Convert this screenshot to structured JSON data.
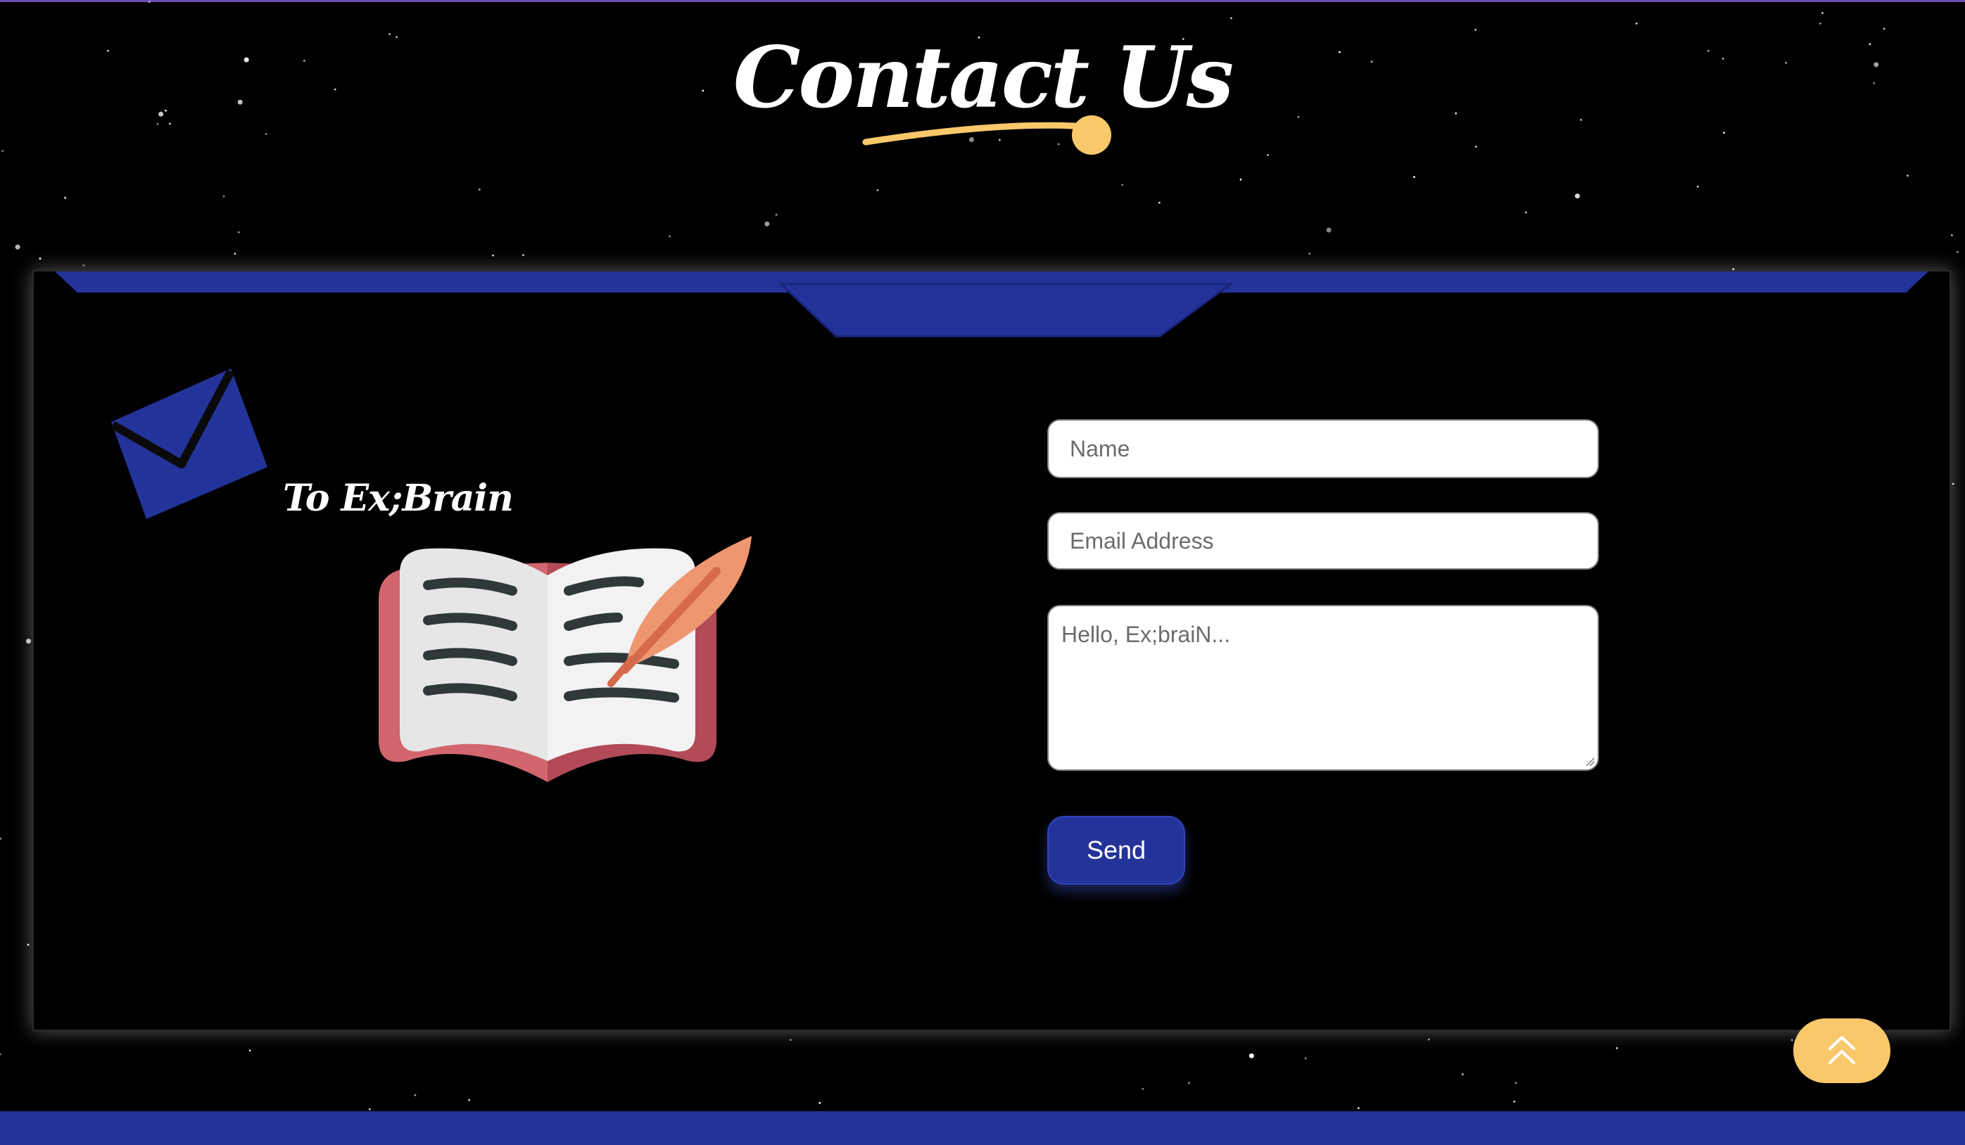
{
  "page": {
    "title": "Contact Us"
  },
  "contact": {
    "tagline": "To Ex;Brain",
    "form": {
      "name_placeholder": "Name",
      "email_placeholder": "Email Address",
      "message_placeholder": "Hello, Ex;braiN...",
      "send_label": "Send"
    }
  },
  "icons": {
    "envelope": "envelope-icon",
    "book": "book-with-quill-icon",
    "back_to_top": "double-chevron-up-icon"
  },
  "colors": {
    "background": "#000000",
    "accent_blue": "#24339a",
    "accent_yellow": "#f9c86a",
    "text_white": "#ffffff"
  }
}
